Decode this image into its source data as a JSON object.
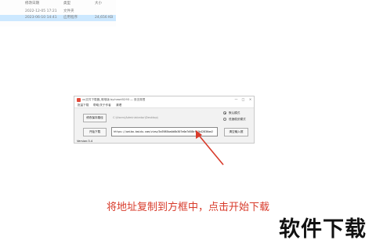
{
  "file_list": {
    "header": {
      "name": "",
      "date": "修改日期",
      "type": "类型",
      "size": "大小"
    },
    "rows": [
      {
        "date": "2022-12-05 17:21",
        "type": "文件夹",
        "size": ""
      },
      {
        "date": "2023-06-10 14:41",
        "type": "应用程序",
        "size": "24,656 KB"
      }
    ]
  },
  "window": {
    "title": "xx文件下载器_唯唯版  by:heart5293 — 双击穿透",
    "controls": {
      "minimize": "—",
      "maximize": "□",
      "close": "×"
    },
    "menu": [
      "批量下载",
      "帮助/关于作者",
      "清理"
    ],
    "save_button": "修改保存路径",
    "save_path": "C:\\Users\\Administrator\\Desktop\\",
    "start_button": "开始下载",
    "url_value": "https://weibo.baidu.com/view/5a3985ba4d0b307e0a7d58bfe2b42836ae2",
    "modes": [
      {
        "label": "默认模式",
        "selected": true
      },
      {
        "label": "低速稳妥模式",
        "selected": false
      }
    ],
    "clear_button": "清空输入框",
    "version": "Version:3.4"
  },
  "annotation": {
    "instruction": "将地址复制到方框中，点击开始下载",
    "watermark": "软件下载",
    "color": "#d83b2b"
  }
}
